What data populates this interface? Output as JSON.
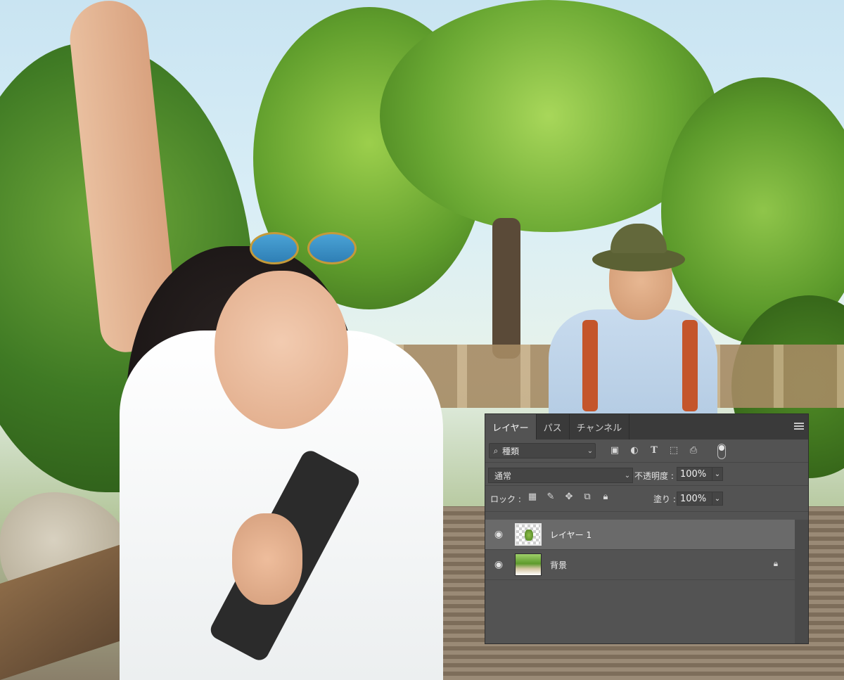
{
  "panel": {
    "tabs": [
      {
        "label": "レイヤー",
        "active": true
      },
      {
        "label": "パス",
        "active": false
      },
      {
        "label": "チャンネル",
        "active": false
      }
    ],
    "menu_icon": "hamburger-menu-icon"
  },
  "filter": {
    "search_icon": "magnifier-icon",
    "kind_label": "種類",
    "icons": [
      "image-filter-icon",
      "adjustment-filter-icon",
      "type-filter-icon",
      "shape-filter-icon",
      "smartobject-filter-icon"
    ],
    "toggle_icon": "filter-toggle-icon"
  },
  "blend": {
    "mode": "通常",
    "opacity_label": "不透明度 :",
    "opacity_value": "100%"
  },
  "lock": {
    "label": "ロック :",
    "icons": [
      "lock-transparent-icon",
      "lock-paint-icon",
      "lock-position-icon",
      "lock-artboard-icon",
      "lock-all-icon"
    ],
    "fill_label": "塗り :",
    "fill_value": "100%"
  },
  "layers": [
    {
      "name": "レイヤー 1",
      "visible": true,
      "selected": true,
      "locked": false,
      "thumb": "transparent"
    },
    {
      "name": "背景",
      "visible": true,
      "selected": false,
      "locked": true,
      "thumb": "photo"
    }
  ]
}
